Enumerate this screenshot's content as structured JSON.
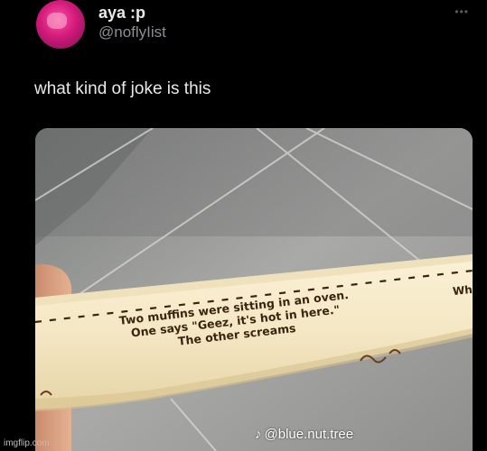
{
  "header": {
    "display_name": "aya :p",
    "handle": "@noflyIist",
    "more_icon": "more-dots-icon"
  },
  "tweet": {
    "text": "what kind of joke is this"
  },
  "photo": {
    "wrapper_text": {
      "line1": "Two muffins were sitting in an oven.",
      "line2": "One says \"Geez, it's hot in here.\"",
      "line3": "The other screams",
      "cut_text": "Wh"
    },
    "watermark": {
      "icon": "tiktok-icon",
      "account": "@blue.nut.tree"
    }
  },
  "footer": {
    "imgflip": "imgflip.com"
  },
  "colors": {
    "background": "#000000",
    "text_primary": "#e7e9ea",
    "text_secondary": "#8b8f94",
    "wrapper": "#f4e7c4"
  }
}
